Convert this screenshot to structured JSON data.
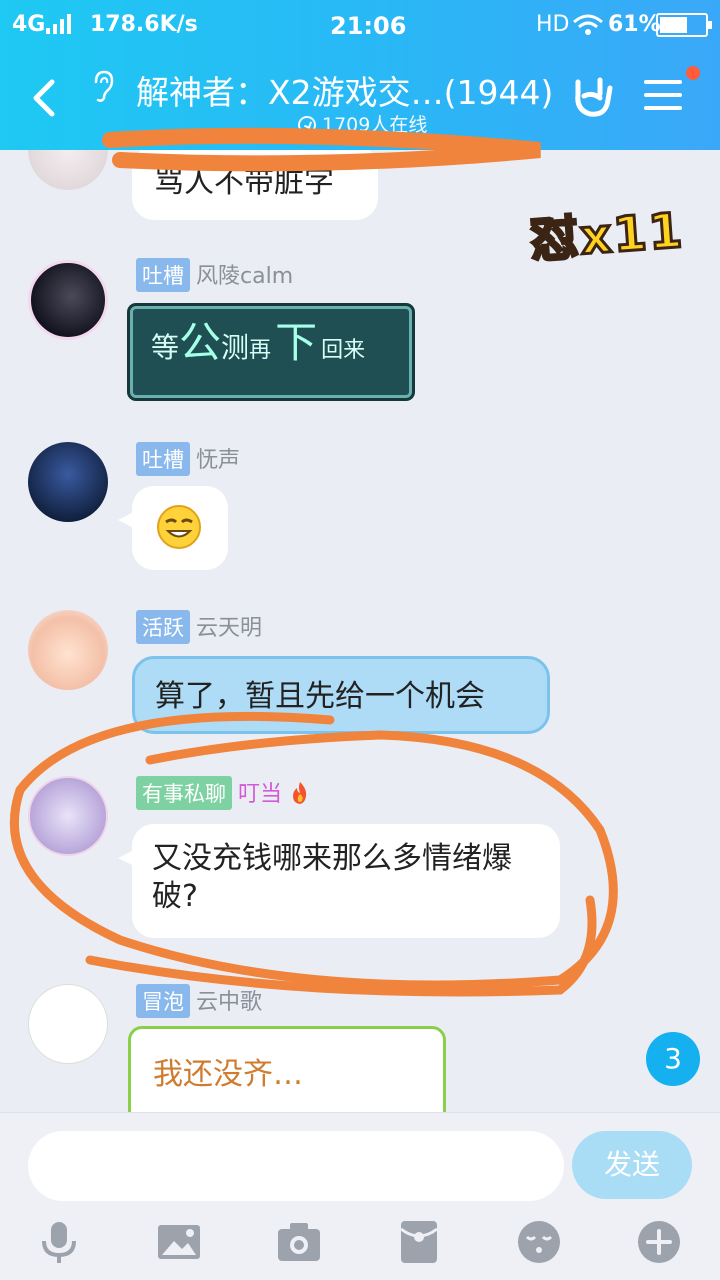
{
  "status_bar": {
    "network": "4G",
    "speed": "178.6K/s",
    "time": "21:06",
    "hd": "HD",
    "battery": "61%",
    "battery_level": 0.61
  },
  "header": {
    "title": "解神者：X2游戏交…(1944)",
    "online": "1709人在线",
    "icons": [
      "back-arrow-icon",
      "ear-icon",
      "rock-hand-icon",
      "menu-icon"
    ]
  },
  "badge": {
    "text": "怼x11"
  },
  "messages": [
    {
      "text": "骂人不带脏字"
    },
    {
      "tag": "吐槽",
      "name": "风陵calm",
      "parts": [
        {
          "t": "等",
          "size": "s"
        },
        {
          "t": "公",
          "size": "b"
        },
        {
          "t": "测",
          "size": "s"
        },
        {
          "t": "再",
          "size": "xs"
        },
        {
          "t": "下",
          "size": "b"
        },
        {
          "t": "回来",
          "size": "xs"
        }
      ]
    },
    {
      "tag": "吐槽",
      "name": "怃声",
      "emoji": "grin-emoji"
    },
    {
      "tag": "活跃",
      "name": "云天明",
      "text": "算了，暂且先给一个机会"
    },
    {
      "tag": "有事私聊",
      "name": "叮当",
      "text": "又没充钱哪来那么多情绪爆破?"
    },
    {
      "tag": "冒泡",
      "name": "云中歌",
      "text": "我还没齐…"
    }
  ],
  "unread_count": "3",
  "input": {
    "placeholder": "",
    "send_label": "发送"
  },
  "toolbar": [
    "microphone-icon",
    "image-icon",
    "camera-icon",
    "red-packet-icon",
    "emoji-icon",
    "plus-icon"
  ],
  "colors": {
    "header": "#2ab7f6",
    "annotation": "#f0843c",
    "send": "#a9dcf5"
  }
}
